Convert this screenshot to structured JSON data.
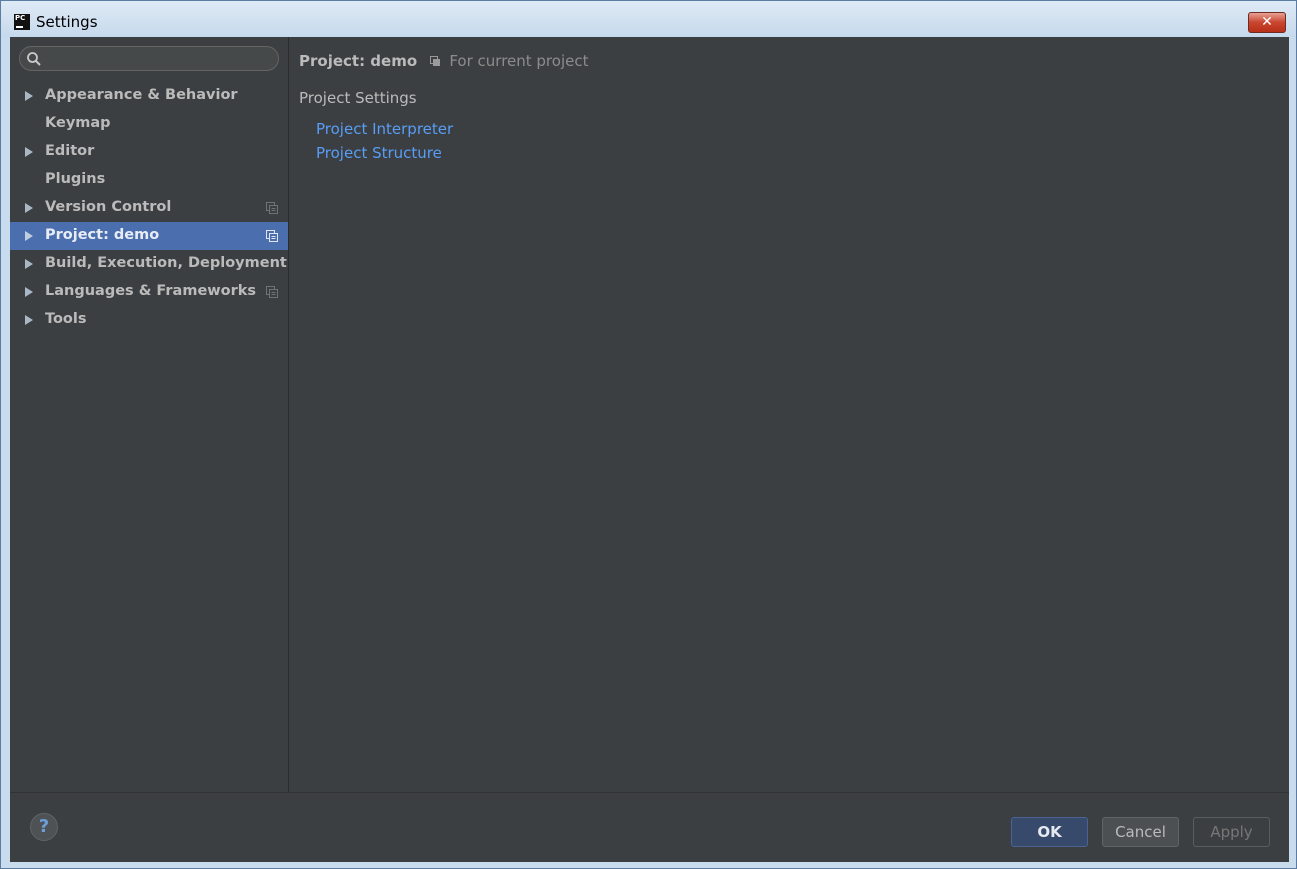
{
  "window": {
    "title": "Settings",
    "app_icon_text": "PC",
    "close_glyph": "✕"
  },
  "search": {
    "value": "",
    "placeholder": ""
  },
  "sidebar": {
    "items": [
      {
        "label": "Appearance & Behavior",
        "expandable": true,
        "project_scope": false,
        "selected": false
      },
      {
        "label": "Keymap",
        "expandable": false,
        "project_scope": false,
        "selected": false
      },
      {
        "label": "Editor",
        "expandable": true,
        "project_scope": false,
        "selected": false
      },
      {
        "label": "Plugins",
        "expandable": false,
        "project_scope": false,
        "selected": false
      },
      {
        "label": "Version Control",
        "expandable": true,
        "project_scope": true,
        "selected": false
      },
      {
        "label": "Project: demo",
        "expandable": true,
        "project_scope": true,
        "selected": true
      },
      {
        "label": "Build, Execution, Deployment",
        "expandable": true,
        "project_scope": false,
        "selected": false
      },
      {
        "label": "Languages & Frameworks",
        "expandable": true,
        "project_scope": true,
        "selected": false
      },
      {
        "label": "Tools",
        "expandable": true,
        "project_scope": false,
        "selected": false
      }
    ]
  },
  "content": {
    "breadcrumb_title": "Project: demo",
    "breadcrumb_note": "For current project",
    "section_title": "Project Settings",
    "links": [
      "Project Interpreter",
      "Project Structure"
    ]
  },
  "footer": {
    "help_label": "?",
    "ok_label": "OK",
    "cancel_label": "Cancel",
    "apply_label": "Apply"
  },
  "colors": {
    "background": "#3c3f41",
    "selection": "#4b6eaf",
    "link": "#589df6",
    "text": "#bbbbbb"
  }
}
